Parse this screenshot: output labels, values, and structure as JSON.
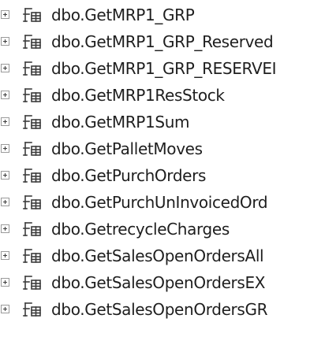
{
  "tree": {
    "items": [
      {
        "label": "dbo.GetMRP1_GRP"
      },
      {
        "label": "dbo.GetMRP1_GRP_Reserved"
      },
      {
        "label": "dbo.GetMRP1_GRP_RESERVEI"
      },
      {
        "label": "dbo.GetMRP1ResStock"
      },
      {
        "label": "dbo.GetMRP1Sum"
      },
      {
        "label": "dbo.GetPalletMoves"
      },
      {
        "label": "dbo.GetPurchOrders"
      },
      {
        "label": "dbo.GetPurchUnInvoicedOrd"
      },
      {
        "label": "dbo.GetrecycleCharges"
      },
      {
        "label": "dbo.GetSalesOpenOrdersAll"
      },
      {
        "label": "dbo.GetSalesOpenOrdersEX"
      },
      {
        "label": "dbo.GetSalesOpenOrdersGR"
      }
    ],
    "expander_icon": "plus-box-icon",
    "item_icon": "table-valued-function-icon"
  }
}
